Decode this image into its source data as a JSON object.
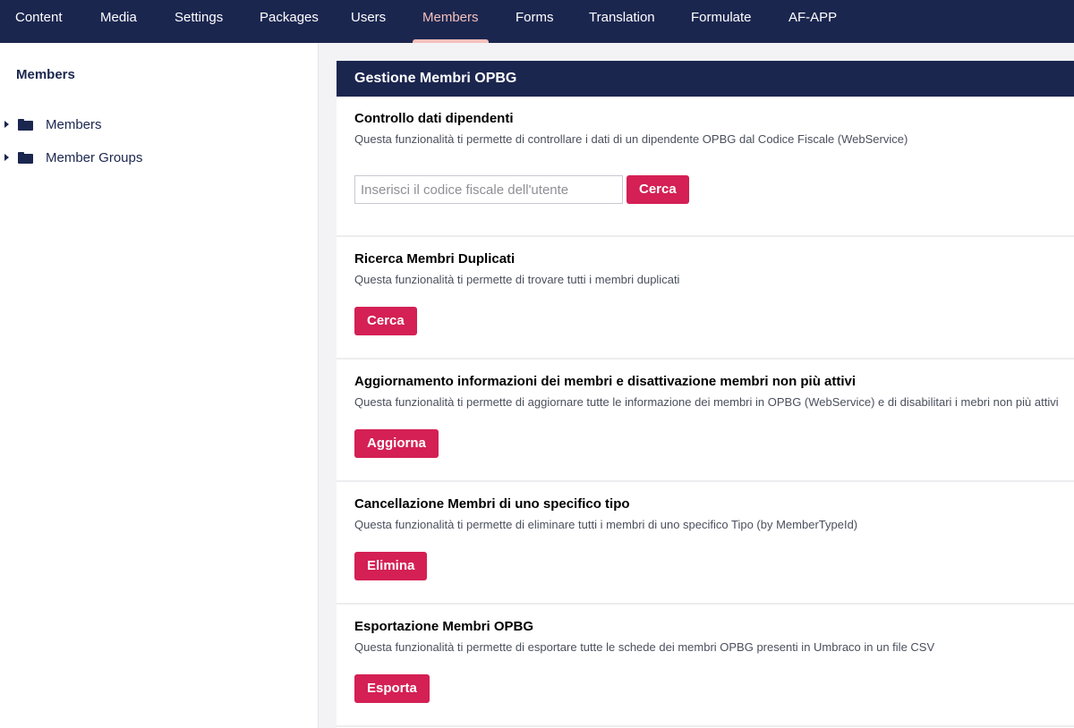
{
  "topnav": {
    "items": [
      {
        "label": "Content"
      },
      {
        "label": "Media"
      },
      {
        "label": "Settings"
      },
      {
        "label": "Packages"
      },
      {
        "label": "Users"
      },
      {
        "label": "Members",
        "active": true
      },
      {
        "label": "Forms"
      },
      {
        "label": "Translation"
      },
      {
        "label": "Formulate"
      },
      {
        "label": "AF-APP"
      }
    ]
  },
  "sidebar": {
    "title": "Members",
    "items": [
      {
        "label": "Members",
        "icon": "folder-icon"
      },
      {
        "label": "Member Groups",
        "icon": "folder-icon"
      }
    ]
  },
  "panel": {
    "title": "Gestione Membri OPBG",
    "sections": [
      {
        "title": "Controllo dati dipendenti",
        "description": "Questa funzionalità ti permette di controllare i dati di un dipendente OPBG dal Codice Fiscale (WebService)",
        "input_placeholder": "Inserisci il codice fiscale dell'utente",
        "button": "Cerca"
      },
      {
        "title": "Ricerca Membri Duplicati",
        "description": "Questa funzionalità ti permette di trovare tutti i membri duplicati",
        "button": "Cerca"
      },
      {
        "title": "Aggiornamento informazioni dei membri e disattivazione membri non più attivi",
        "description": "Questa funzionalità ti permette di aggiornare tutte le informazione dei membri in OPBG (WebService) e di disabilitari i mebri non più attivi",
        "button": "Aggiorna"
      },
      {
        "title": "Cancellazione Membri di uno specifico tipo",
        "description": "Questa funzionalità ti permette di eliminare tutti i membri di uno specifico Tipo (by MemberTypeId)",
        "button": "Elimina"
      },
      {
        "title": "Esportazione Membri OPBG",
        "description": "Questa funzionalità ti permette di esportare tutte le schede dei membri OPBG presenti in Umbraco in un file CSV",
        "button": "Esporta"
      }
    ]
  },
  "colors": {
    "nav_bg": "#1b264f",
    "accent": "#d42054",
    "active_nav": "#f5c1bc"
  }
}
